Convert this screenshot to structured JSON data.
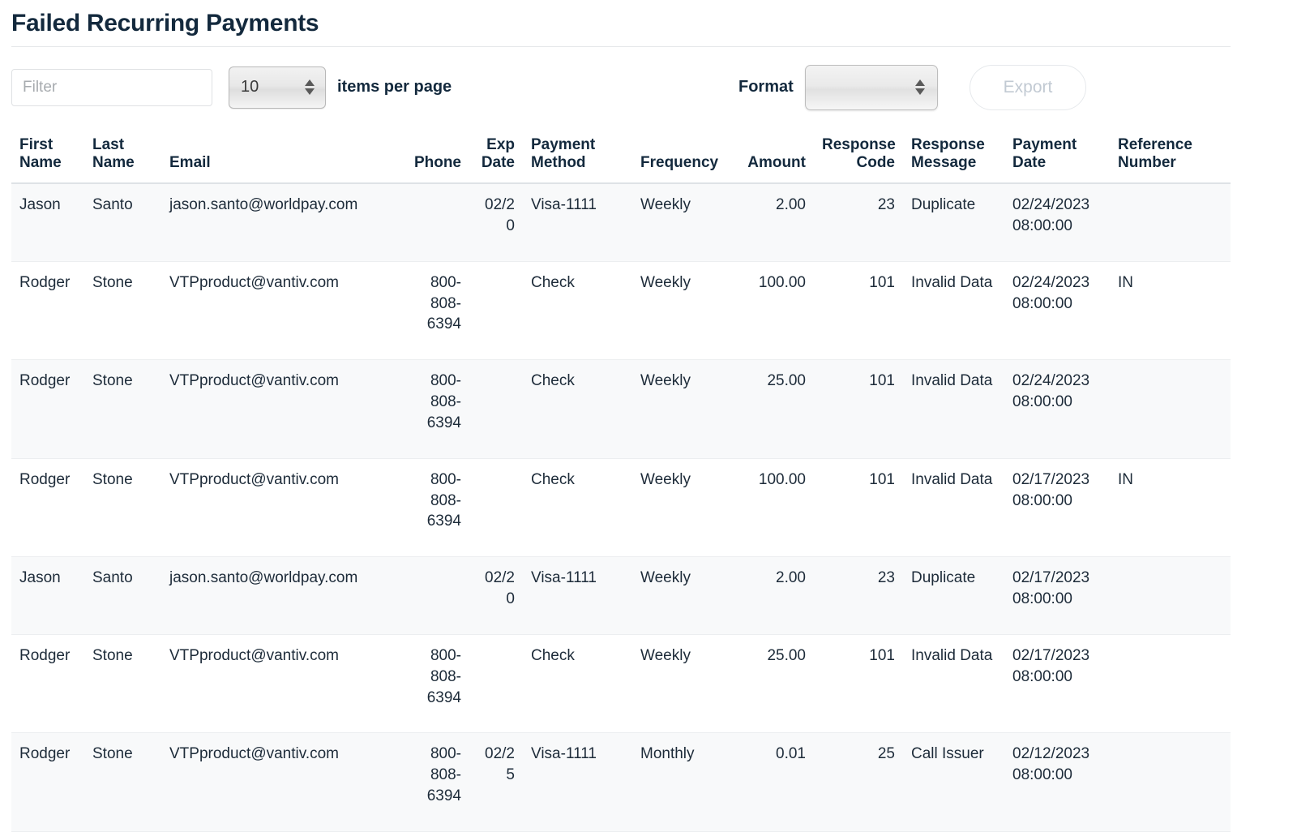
{
  "header": {
    "title": "Failed Recurring Payments"
  },
  "toolbar": {
    "filter_placeholder": "Filter",
    "filter_value": "",
    "items_per_page_value": "10",
    "items_per_page_label": "items per page",
    "format_label": "Format",
    "format_value": "",
    "format_options": [
      ""
    ],
    "export_label": "Export"
  },
  "table": {
    "columns": [
      {
        "key": "first_name",
        "label": "First Name",
        "align": "left"
      },
      {
        "key": "last_name",
        "label": "Last Name",
        "align": "left"
      },
      {
        "key": "email",
        "label": "Email",
        "align": "left"
      },
      {
        "key": "phone",
        "label": "Phone",
        "align": "right"
      },
      {
        "key": "exp_date",
        "label": "Exp Date",
        "align": "right"
      },
      {
        "key": "payment_method",
        "label": "Payment Method",
        "align": "left"
      },
      {
        "key": "frequency",
        "label": "Frequency",
        "align": "left"
      },
      {
        "key": "amount",
        "label": "Amount",
        "align": "right"
      },
      {
        "key": "response_code",
        "label": "Response Code",
        "align": "right"
      },
      {
        "key": "response_message",
        "label": "Response Message",
        "align": "left"
      },
      {
        "key": "payment_date",
        "label": "Payment Date",
        "align": "left"
      },
      {
        "key": "reference_number",
        "label": "Reference Number",
        "align": "left"
      }
    ],
    "rows": [
      {
        "first_name": "Jason",
        "last_name": "Santo",
        "email": "jason.santo@worldpay.com",
        "phone": "",
        "exp_date": "02/20",
        "payment_method": "Visa-1111",
        "frequency": "Weekly",
        "amount": "2.00",
        "response_code": "23",
        "response_message": "Duplicate",
        "payment_date": "02/24/2023 08:00:00",
        "reference_number": ""
      },
      {
        "first_name": "Rodger",
        "last_name": "Stone",
        "email": "VTPproduct@vantiv.com",
        "phone": "800-808-6394",
        "exp_date": "",
        "payment_method": "Check",
        "frequency": "Weekly",
        "amount": "100.00",
        "response_code": "101",
        "response_message": "Invalid Data",
        "payment_date": "02/24/2023 08:00:00",
        "reference_number": "IN"
      },
      {
        "first_name": "Rodger",
        "last_name": "Stone",
        "email": "VTPproduct@vantiv.com",
        "phone": "800-808-6394",
        "exp_date": "",
        "payment_method": "Check",
        "frequency": "Weekly",
        "amount": "25.00",
        "response_code": "101",
        "response_message": "Invalid Data",
        "payment_date": "02/24/2023 08:00:00",
        "reference_number": ""
      },
      {
        "first_name": "Rodger",
        "last_name": "Stone",
        "email": "VTPproduct@vantiv.com",
        "phone": "800-808-6394",
        "exp_date": "",
        "payment_method": "Check",
        "frequency": "Weekly",
        "amount": "100.00",
        "response_code": "101",
        "response_message": "Invalid Data",
        "payment_date": "02/17/2023 08:00:00",
        "reference_number": "IN"
      },
      {
        "first_name": "Jason",
        "last_name": "Santo",
        "email": "jason.santo@worldpay.com",
        "phone": "",
        "exp_date": "02/20",
        "payment_method": "Visa-1111",
        "frequency": "Weekly",
        "amount": "2.00",
        "response_code": "23",
        "response_message": "Duplicate",
        "payment_date": "02/17/2023 08:00:00",
        "reference_number": ""
      },
      {
        "first_name": "Rodger",
        "last_name": "Stone",
        "email": "VTPproduct@vantiv.com",
        "phone": "800-808-6394",
        "exp_date": "",
        "payment_method": "Check",
        "frequency": "Weekly",
        "amount": "25.00",
        "response_code": "101",
        "response_message": "Invalid Data",
        "payment_date": "02/17/2023 08:00:00",
        "reference_number": ""
      },
      {
        "first_name": "Rodger",
        "last_name": "Stone",
        "email": "VTPproduct@vantiv.com",
        "phone": "800-808-6394",
        "exp_date": "02/25",
        "payment_method": "Visa-1111",
        "frequency": "Monthly",
        "amount": "0.01",
        "response_code": "25",
        "response_message": "Call Issuer",
        "payment_date": "02/12/2023 08:00:00",
        "reference_number": ""
      }
    ]
  },
  "colors": {
    "title": "#13293d",
    "row_stripe": "#f8f9fa",
    "border": "#dee2e6",
    "disabled_text": "#c2cad3"
  }
}
